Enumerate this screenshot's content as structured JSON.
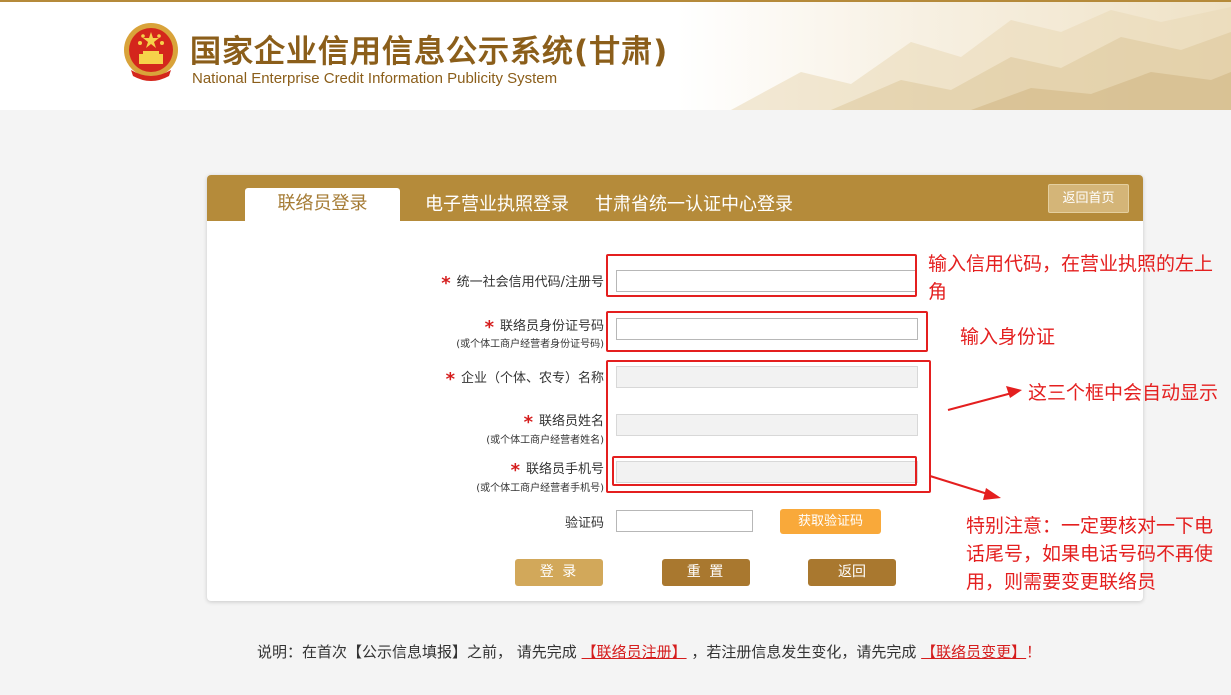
{
  "header": {
    "title": "国家企业信用信息公示系统(甘肃)",
    "subtitle": "National Enterprise Credit Information Publicity System"
  },
  "tabs": [
    {
      "label": "联络员登录",
      "active": true
    },
    {
      "label": "电子营业执照登录",
      "active": false
    },
    {
      "label": "甘肃省统一认证中心登录",
      "active": false
    }
  ],
  "home_button": "返回首页",
  "form": {
    "credit_code": {
      "label": "统一社会信用代码/注册号",
      "value": ""
    },
    "id_number": {
      "label": "联络员身份证号码",
      "sublabel": "(或个体工商户经营者身份证号码)",
      "value": ""
    },
    "company_name": {
      "label": "企业（个体、农专）名称",
      "value": ""
    },
    "contact_name": {
      "label": "联络员姓名",
      "sublabel": "(或个体工商户经营者姓名)",
      "value": ""
    },
    "contact_phone": {
      "label": "联络员手机号",
      "sublabel": "(或个体工商户经营者手机号)",
      "value": ""
    },
    "verify_code": {
      "label": "验证码",
      "value": ""
    }
  },
  "buttons": {
    "get_code": "获取验证码",
    "login": "登 录",
    "reset": "重 置",
    "back": "返回"
  },
  "note": {
    "prefix": "说明：在首次【公示信息填报】之前， 请先完成",
    "link1": "【联络员注册】",
    "middle": "，若注册信息发生变化，请先完成",
    "link2": "【联络员变更】",
    "suffix": "！"
  },
  "annotations": {
    "credit_code": "输入信用代码，在营业执照的左上角",
    "id_number": "输入身份证",
    "auto_fill": "这三个框中会自动显示",
    "phone_note": "特别注意：一定要核对一下电话尾号，如果电话号码不再使用，则需要变更联络员"
  },
  "colors": {
    "brand_gold": "#b58b3a",
    "annotation_red": "#e41f1f",
    "get_code_orange": "#f9a93a"
  }
}
